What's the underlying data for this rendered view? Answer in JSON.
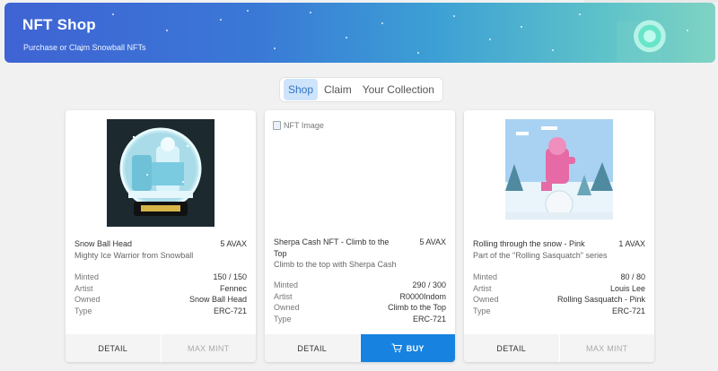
{
  "header": {
    "title": "NFT Shop",
    "subtitle": "Purchase or Claim Snowball NFTs"
  },
  "tabs": [
    {
      "label": "Shop",
      "active": true
    },
    {
      "label": "Claim",
      "active": false
    },
    {
      "label": "Your Collection",
      "active": false
    }
  ],
  "cards": [
    {
      "name": "Snow Ball Head",
      "price": "5 AVAX",
      "description": "Mighty Ice Warrior from Snowball",
      "image_alt": "",
      "info": [
        {
          "key": "Minted",
          "value": "150 / 150"
        },
        {
          "key": "Artist",
          "value": "Fennec"
        },
        {
          "key": "Owned",
          "value": "Snow Ball Head"
        },
        {
          "key": "Type",
          "value": "ERC-721"
        }
      ],
      "detail_label": "DETAIL",
      "action_label": "MAX MINT"
    },
    {
      "name": "Sherpa Cash NFT - Climb to the Top",
      "price": "5 AVAX",
      "description": "Climb to the top with Sherpa Cash",
      "image_alt": "NFT Image",
      "info": [
        {
          "key": "Minted",
          "value": "290 / 300"
        },
        {
          "key": "Artist",
          "value": "R0000Indom"
        },
        {
          "key": "Owned",
          "value": "Climb to the Top"
        },
        {
          "key": "Type",
          "value": "ERC-721"
        }
      ],
      "detail_label": "DETAIL",
      "action_label": "BUY"
    },
    {
      "name": "Rolling through the snow - Pink",
      "price": "1 AVAX",
      "description": "Part of the \"Rolling Sasquatch\" series",
      "image_alt": "",
      "info": [
        {
          "key": "Minted",
          "value": "80 / 80"
        },
        {
          "key": "Artist",
          "value": "Louis Lee"
        },
        {
          "key": "Owned",
          "value": "Rolling Sasquatch - Pink"
        },
        {
          "key": "Type",
          "value": "ERC-721"
        }
      ],
      "detail_label": "DETAIL",
      "action_label": "MAX MINT"
    }
  ],
  "colors": {
    "accent": "#1782e0",
    "tab_active_bg": "#cde4fb"
  }
}
